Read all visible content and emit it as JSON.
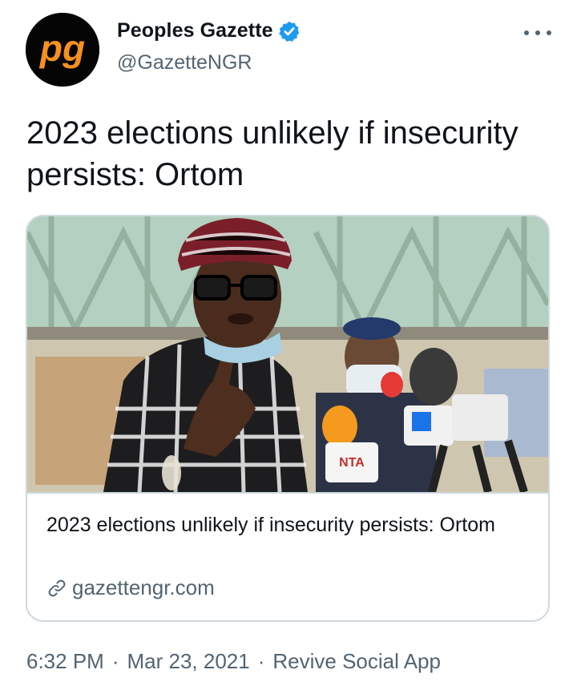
{
  "author": {
    "display_name": "Peoples Gazette",
    "handle": "@GazetteNGR",
    "avatar_text": "pg",
    "verified": true
  },
  "icons": {
    "avatar": "peoples-gazette-logo",
    "verified": "verified-badge-icon",
    "more": "more-options-icon",
    "link": "link-icon"
  },
  "tweet": {
    "text": "2023 elections unlikely if insecurity persists: Ortom"
  },
  "card": {
    "image_description": "Man in checked shirt and striped cap speaking into microphones",
    "title": "2023 elections unlikely if insecurity persists: Ortom",
    "domain": "gazettengr.com",
    "mic_label": "NTA"
  },
  "meta": {
    "time": "6:32 PM",
    "separator": "·",
    "date": "Mar 23, 2021",
    "source": "Revive Social App"
  },
  "colors": {
    "brand_orange": "#f7901e",
    "verified_blue": "#1d9bf0",
    "secondary_text": "#536471",
    "border": "#cfd9de"
  }
}
